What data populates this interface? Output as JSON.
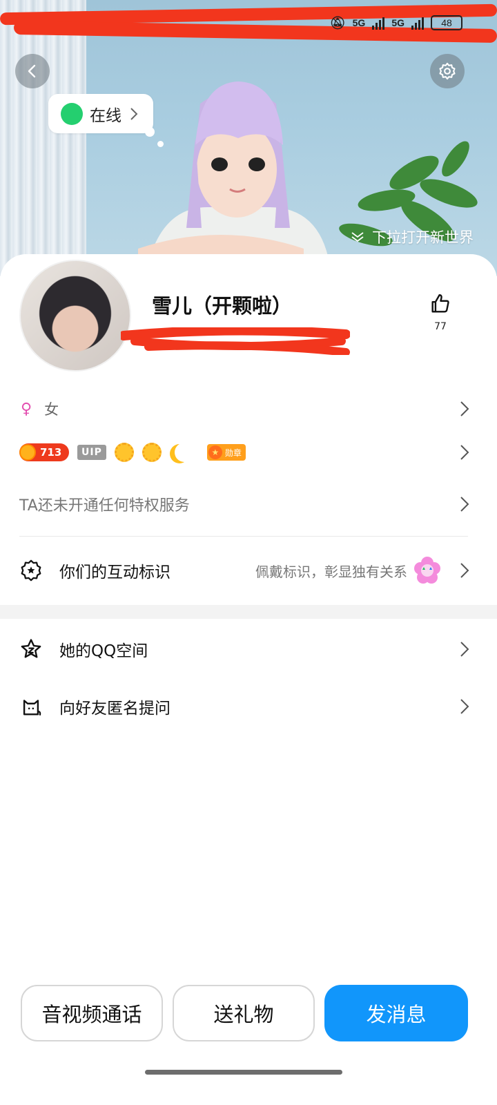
{
  "status_bar": {
    "network_left": "5G",
    "network_right": "5G",
    "battery": "48"
  },
  "header": {
    "back_icon": "chevron-left-icon",
    "settings_icon": "gear-icon",
    "online_status": "在线",
    "pull_hint": "下拉打开新世界"
  },
  "profile": {
    "nickname": "雪儿（开颗啦）",
    "like_count": "77"
  },
  "info": {
    "gender": "女",
    "level": "713",
    "vip_tag": "UIP",
    "medal_label": "勋章",
    "privilege_text": "TA还未开通任何特权服务"
  },
  "interaction": {
    "label": "你们的互动标识",
    "hint": "佩戴标识，彰显独有关系"
  },
  "menu": {
    "qzone": "她的QQ空间",
    "ask": "向好友匿名提问"
  },
  "actions": {
    "call": "音视频通话",
    "gift": "送礼物",
    "message": "发消息"
  },
  "colors": {
    "accent": "#1196fb",
    "online": "#24cf6f",
    "level": "#ee3a1d",
    "redaction": "#f2361d"
  }
}
